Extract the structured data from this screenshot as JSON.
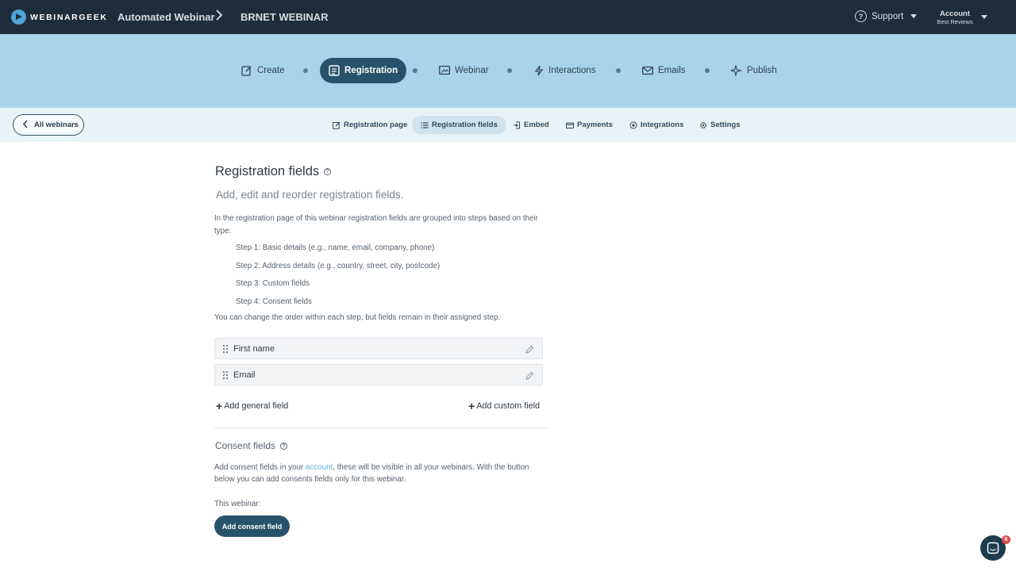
{
  "header": {
    "logo_text": "WEBINARGEEK",
    "breadcrumb_1": "Automated Webinar",
    "breadcrumb_2": "BRNET WEBINAR",
    "support_label": "Support",
    "account_title": "Account",
    "account_subtitle": "Best Reviews"
  },
  "steps": [
    {
      "label": "Create",
      "icon": "pencil-square-icon",
      "active": false
    },
    {
      "label": "Registration",
      "icon": "form-icon",
      "active": true
    },
    {
      "label": "Webinar",
      "icon": "monitor-icon",
      "active": false
    },
    {
      "label": "Interactions",
      "icon": "lightning-icon",
      "active": false
    },
    {
      "label": "Emails",
      "icon": "envelope-icon",
      "active": false
    },
    {
      "label": "Publish",
      "icon": "sparkle-icon",
      "active": false
    }
  ],
  "subnav": {
    "back_label": "All webinars",
    "tabs": [
      {
        "label": "Registration page",
        "icon": "edit-icon",
        "active": false
      },
      {
        "label": "Registration fields",
        "icon": "list-icon",
        "active": true
      },
      {
        "label": "Embed",
        "icon": "embed-icon",
        "active": false
      },
      {
        "label": "Payments",
        "icon": "card-icon",
        "active": false
      },
      {
        "label": "Integrations",
        "icon": "integration-icon",
        "active": false
      },
      {
        "label": "Settings",
        "icon": "gear-icon",
        "active": false
      }
    ]
  },
  "main": {
    "title": "Registration fields",
    "subtitle": "Add, edit and reorder registration fields.",
    "intro": "In the registration page of this webinar registration fields are grouped into steps based on their type:",
    "step_items": [
      "Step 1: Basic details (e.g., name, email, company, phone)",
      "Step 2: Address details (e.g., country, street, city, postcode)",
      "Step 3: Custom fields",
      "Step 4: Consent fields"
    ],
    "note": "You can change the order within each step, but fields remain in their assigned step.",
    "fields": [
      "First name",
      "Email"
    ],
    "add_general_label": "Add general field",
    "add_custom_label": "Add custom field"
  },
  "consent": {
    "title": "Consent fields",
    "text_before_link": "Add consent fields in your ",
    "link_text": "account",
    "text_after_link": ", these will be visible in all your webinars. With the button below you can add consents fields only for this webinar.",
    "this_webinar_label": "This webinar:",
    "add_button_label": "Add consent field"
  },
  "chat": {
    "badge_count": "6"
  },
  "colors": {
    "topbar": "#1e2d3b",
    "steps_bg": "#a9d3e8",
    "accent": "#27536a",
    "link": "#5fb3dc"
  }
}
